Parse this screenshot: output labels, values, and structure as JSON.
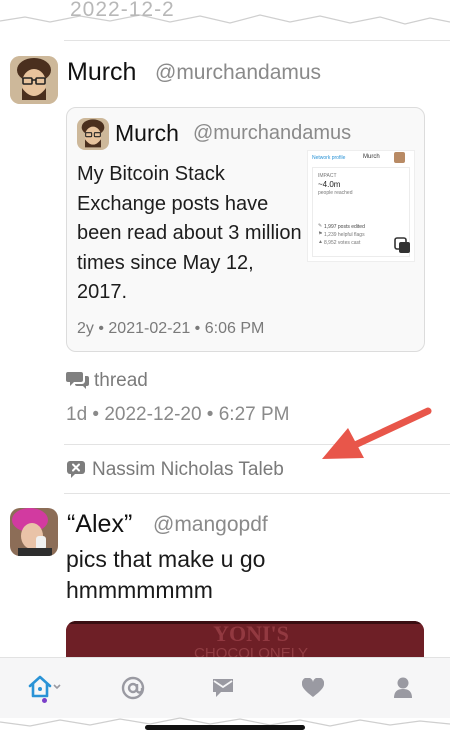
{
  "cut_top_text": "2022-12-2",
  "post1": {
    "name": "Murch",
    "handle": "@murchandamus",
    "quote": {
      "name": "Murch",
      "handle": "@murchandamus",
      "text": "My Bitcoin Stack Exchange posts have been read about 3 million times since May 12, 2017.",
      "meta": "2y • 2021-02-21 • 6:06 PM",
      "thumbnail": {
        "header_link": "Network profile",
        "header_name": "Murch",
        "section": "IMPACT",
        "reach_value": "~4.0m",
        "reach_label": "people reached",
        "stat1": "1,997 posts edited",
        "stat2": "1,239 helpful flags",
        "stat3": "8,952 votes cast"
      }
    },
    "thread_label": "thread",
    "meta": "1d • 2022-12-20 • 6:27 PM"
  },
  "repost": {
    "label": "Nassim Nicholas Taleb"
  },
  "post2": {
    "name": "“Alex”",
    "handle": "@mangopdf",
    "text": "pics that make u go hmmmmmmm",
    "image_lettering": "YONI'S CHOCOLONELY"
  },
  "tabs": [
    {
      "icon": "home-icon",
      "active": true
    },
    {
      "icon": "at-icon"
    },
    {
      "icon": "mail-icon"
    },
    {
      "icon": "heart-icon"
    },
    {
      "icon": "person-icon"
    }
  ],
  "colors": {
    "accent": "#2a93d6",
    "arrow": "#e8564a",
    "muted": "#8a8a8a",
    "tab_icon": "#9a9aa2"
  }
}
